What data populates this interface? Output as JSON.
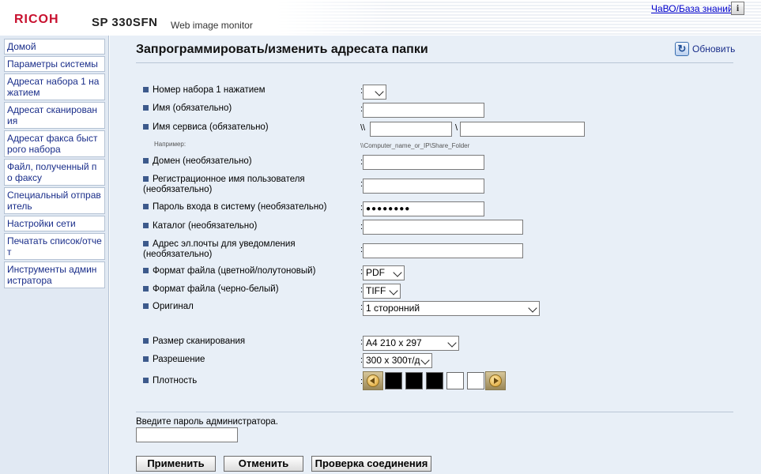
{
  "header": {
    "logo": "RICOH",
    "model": "SP 330SFN",
    "subtitle": "Web image monitor",
    "faq_link": "ЧаВО/База знаний",
    "info_icon": "i"
  },
  "sidebar": {
    "items": [
      {
        "label": "Домой"
      },
      {
        "label": "Параметры системы"
      },
      {
        "label": "Адресат набора 1 нажатием"
      },
      {
        "label": "Адресат сканирования"
      },
      {
        "label": "Адресат факса быстрого набора"
      },
      {
        "label": "Файл, полученный по факсу"
      },
      {
        "label": "Специальный отправитель"
      },
      {
        "label": "Настройки сети"
      },
      {
        "label": "Печатать список/отчет"
      },
      {
        "label": "Инструменты администратора"
      }
    ]
  },
  "main": {
    "title": "Запрограммировать/изменить адресата папки",
    "refresh_label": "Обновить",
    "form": {
      "quick_dial_label": "Номер набора 1 нажатием",
      "quick_dial_value": "",
      "name_label": "Имя (обязательно)",
      "name_value": "",
      "service_label": "Имя сервиса (обязательно)",
      "service_prefix": "\\\\",
      "service_sep": "\\",
      "service_host": "",
      "service_share": "",
      "example_label": "Например:",
      "example_value": "\\\\Computer_name_or_IP\\Share_Folder",
      "domain_label": "Домен (необязательно)",
      "domain_value": "",
      "username_label_1": "Регистрационное имя пользователя",
      "username_label_2": "(необязательно)",
      "username_value": "",
      "password_label": "Пароль входа в систему (необязательно)",
      "password_value": "●●●●●●●●",
      "catalog_label": "Каталог (необязательно)",
      "catalog_value": "",
      "email_label_1": "Адрес эл.почты для уведомления",
      "email_label_2": "(необязательно)",
      "email_value": "",
      "color_format_label": "Формат файла (цветной/полутоновый)",
      "color_format_value": "PDF",
      "bw_format_label": "Формат файла (черно-белый)",
      "bw_format_value": "TIFF",
      "original_label": "Оригинал",
      "original_value": "1 сторонний",
      "scan_size_label": "Размер сканирования",
      "scan_size_value": "A4 210 x 297",
      "resolution_label": "Разрешение",
      "resolution_value": "300 x 300т/д",
      "density_label": "Плотность",
      "density_level": 3,
      "density_max": 5,
      "colon": ":"
    },
    "admin_password_label": "Введите пароль администратора.",
    "admin_password_value": "",
    "buttons": {
      "apply": "Применить",
      "cancel": "Отменить",
      "test": "Проверка соединения"
    }
  },
  "colors": {
    "sidebar_bg": "#e1e9f3",
    "main_bg": "#e8eff7",
    "nav_text": "#1a2e8a",
    "bullet": "#3d5a8c",
    "logo_red": "#c8102e"
  }
}
